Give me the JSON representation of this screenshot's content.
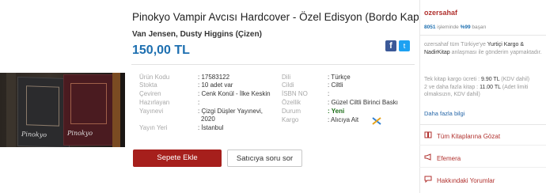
{
  "product": {
    "title": "Pinokyo Vampir Avcısı Hardcover - Özel Edisyon (Bordo Kapak)",
    "authors": "Van Jensen, Dusty Higgins (Çizen)",
    "price": "150,00 TL",
    "cover_text_left": "Pinokyo",
    "cover_text_right": "Pinokyo"
  },
  "share": {
    "facebook": "f",
    "twitter": "t"
  },
  "details_left": [
    {
      "label": "Ürün Kodu",
      "value": ": 17583122"
    },
    {
      "label": "Stokta",
      "value": ": 10 adet var"
    },
    {
      "label": "Çeviren",
      "value": ": Cenk Konül - İlke Keskin"
    },
    {
      "label": "Hazırlayan",
      "value": ":"
    },
    {
      "label": "Yayınevi",
      "value": ": Çizgi Düşler Yayınevi,"
    },
    {
      "label": "",
      "value": "2020"
    },
    {
      "label": "Yayın Yeri",
      "value": ": İstanbul"
    }
  ],
  "details_right": [
    {
      "label": "Dili",
      "value": ": Türkçe"
    },
    {
      "label": "Cildi",
      "value": ": Ciltli"
    },
    {
      "label": "İSBN NO",
      "value": ":"
    },
    {
      "label": "Özellik",
      "value": ": Güzel Ciltli Birinci Baskı"
    },
    {
      "label": "Durum",
      "value": ": Yeni"
    },
    {
      "label": "Kargo",
      "value": ": Alıcıya Ait"
    }
  ],
  "buttons": {
    "add_to_cart": "Sepete Ekle",
    "ask_seller": "Satıcıya soru sor"
  },
  "seller": {
    "name": "ozersahaf",
    "sales_count": "8051",
    "sales_text": "işleminde",
    "rating": "%99",
    "rating_text": "başarı",
    "shipping_note_1": "ozersahaf tüm Türkiye'ye",
    "shipping_note_brand": "Yurtiçi Kargo & NadirKitap",
    "shipping_note_2": "anlaşması ile gönderim yapmaktadır.",
    "cost_line_1_prefix": "Tek kitap kargo ücreti :",
    "cost_line_1_value": "9.90 TL",
    "cost_line_1_suffix": "(KDV dahil)",
    "cost_line_2_prefix": "2 ve daha fazla kitap :",
    "cost_line_2_value": "11.00 TL",
    "cost_line_2_suffix": "(Adet limiti olmaksızın, KDV dahil)",
    "more_info": "Daha fazla bilgi"
  },
  "menu": [
    {
      "icon": "book-icon",
      "label": "Tüm Kitaplarına Gözat"
    },
    {
      "icon": "megaphone-icon",
      "label": "Efemera"
    },
    {
      "icon": "chat-icon",
      "label": "Hakkındaki Yorumlar"
    }
  ]
}
